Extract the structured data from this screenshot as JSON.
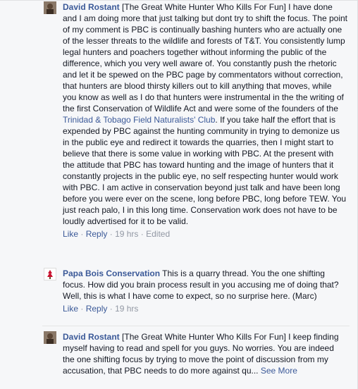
{
  "comments": [
    {
      "author": "David Rostant",
      "text_before_link": "[The Great White Hunter Who Kills For Fun] I have done and I am doing more that just talking but dont try to shift the focus. The point of my comment is PBC is continually bashing hunters who are actually one of the lesser threats to the wildlife and forests of T&T. You consistently lump legal hunters and poachers together without informing the public of the difference, which you very well aware of. You constantly push the rhetoric and let it be spewed on the PBC page by commentators without correction, that hunters are blood thirsty killers out to kill anything that moves, while you know as well as I do that hunters were instrumental in the the writing of the first Conservation of Wildlife Act and were some of the founders of the ",
      "link_text": "Trinidad & Tobago Field Naturalists' Club",
      "text_after_link": ". If you take half the effort that is expended by PBC against the hunting community in trying to demonize us in the public eye and redirect it towards the quarries, then I might start to believe that there is some value in working with PBC. At the present with the attitude that PBC has toward hunting and the image of hunters that it constantly projects in the public eye, no self respecting hunter would work with PBC. I am active in conservation beyond just talk and have been long before you were ever on the scene, long before PBC, long before TEW. You just reach palo, I in this long time. Conservation work does not have to be loudly advertised for it to be valid.",
      "like": "Like",
      "reply": "Reply",
      "time": "19 hrs",
      "edited": "Edited"
    },
    {
      "author": "Papa Bois Conservation",
      "text": "This is a quarry thread. You the one shifting focus. How did you brain process result in you accusing me of doing that? Well, this is what I have come to expect, so no surprise here. (Marc)",
      "like": "Like",
      "reply": "Reply",
      "time": "19 hrs"
    },
    {
      "author": "David Rostant",
      "text": "[The Great White Hunter Who Kills For Fun] I keep finding myself having to read and spell for you guys. No worries. You are indeed the one shifting focus by trying to move the point of discussion from my accusation, that PBC needs to do more against qu...",
      "see_more": "See More"
    }
  ],
  "separator": "·"
}
